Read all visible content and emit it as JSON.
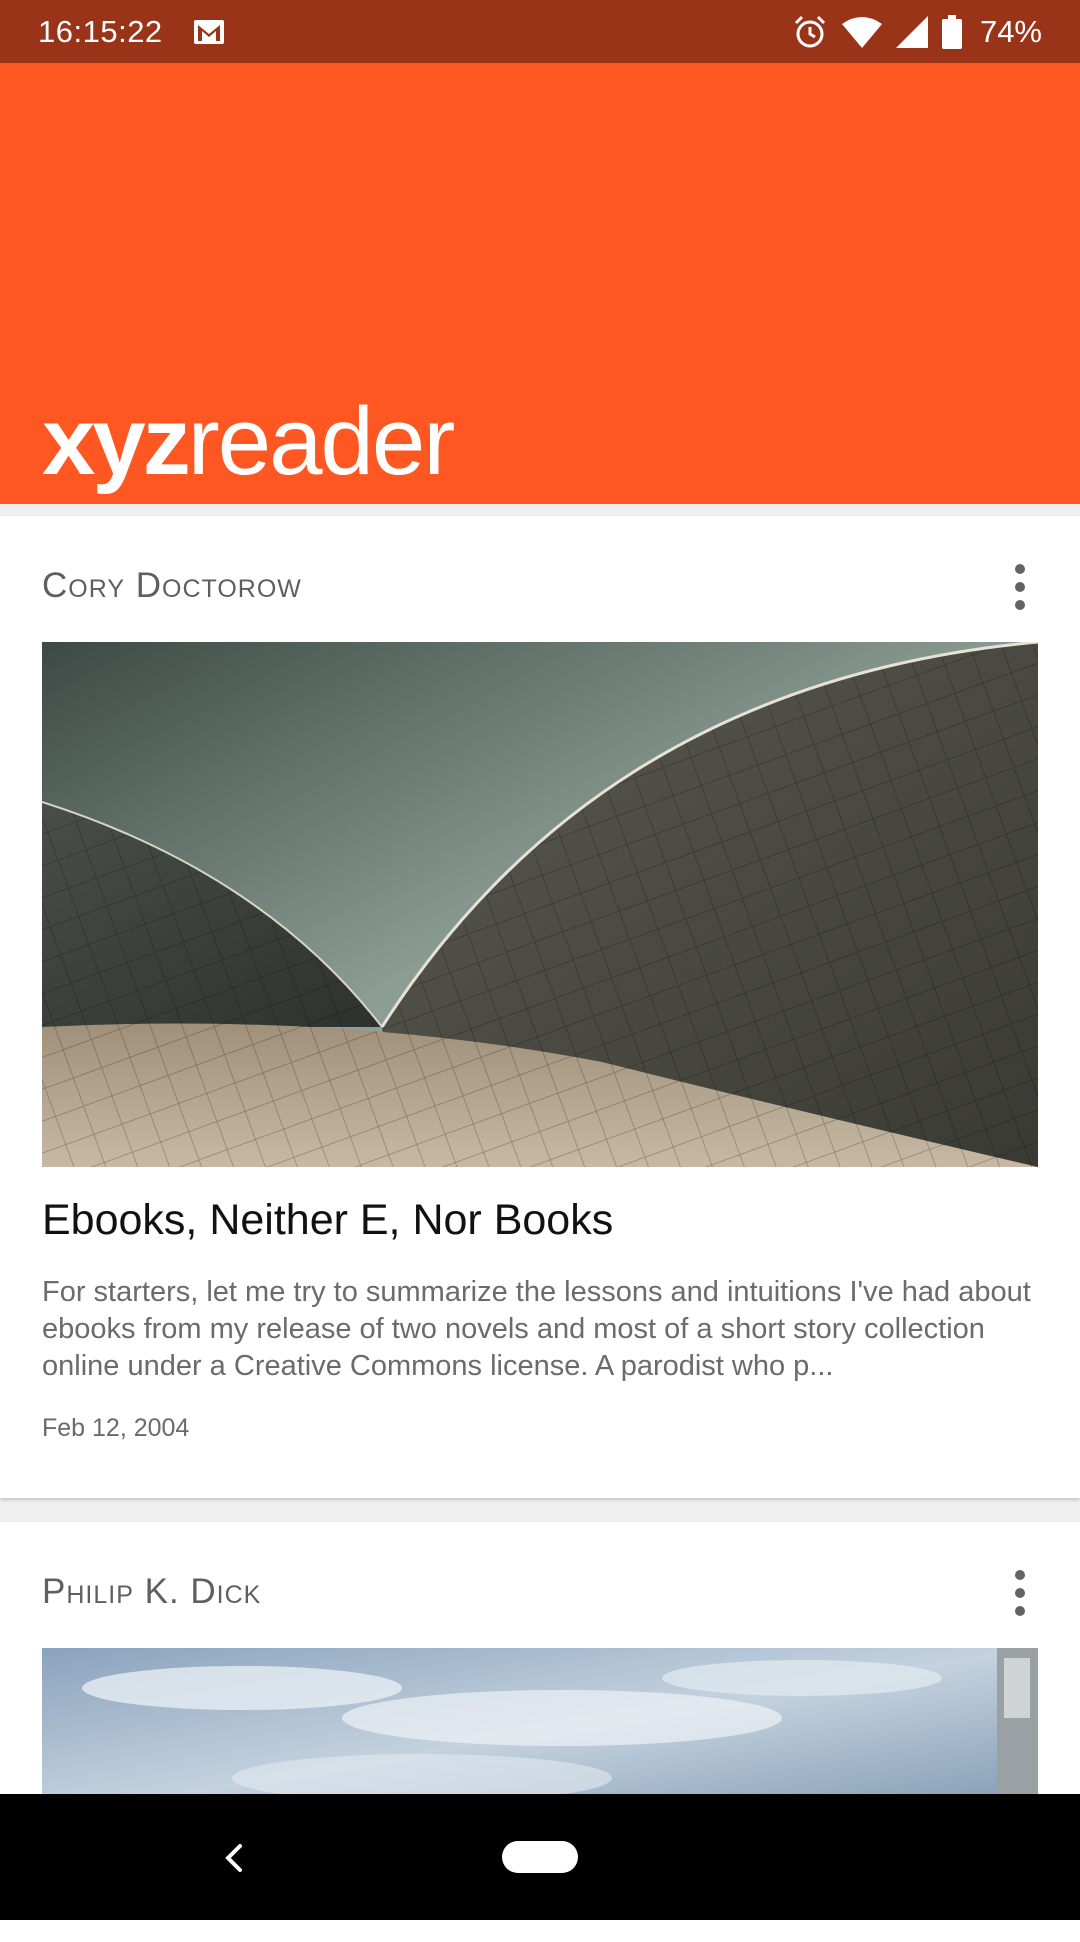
{
  "status_bar": {
    "time": "16:15:22",
    "battery_percent": "74%",
    "icons": [
      "gmail-icon",
      "alarm-icon",
      "wifi-icon",
      "signal-icon",
      "battery-icon"
    ]
  },
  "app_bar": {
    "logo_bold": "xyz",
    "logo_light": "reader",
    "background": "#ff5722"
  },
  "articles": [
    {
      "author": "Cory Doctorow",
      "title": "Ebooks, Neither E, Nor Books",
      "excerpt": "For starters, let me try to summarize the lessons and intuitions I've had about ebooks from my release of two novels and most of a short story collection online under a Creative Commons license. A parodist who p...",
      "date": "Feb 12, 2004",
      "menu_icon": "more-vert-icon"
    },
    {
      "author": "Philip K. Dick",
      "menu_icon": "more-vert-icon"
    }
  ],
  "colors": {
    "status_bar": "#9a3418",
    "accent": "#ff5722",
    "card": "#ffffff",
    "background": "#efefef"
  }
}
